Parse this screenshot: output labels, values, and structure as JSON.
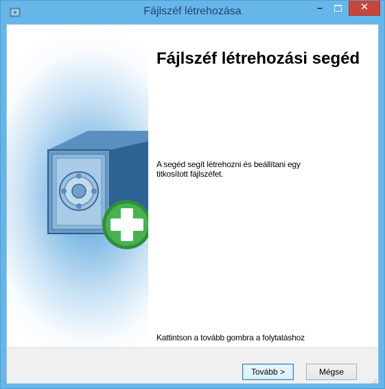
{
  "window": {
    "title": "Fájlszéf létrehozása",
    "controls": {
      "minimize": "–",
      "close": "✕"
    }
  },
  "wizard": {
    "heading": "Fájlszéf létrehozási segéd",
    "description": "A segéd segít létrehozni és beállítani egy titkosított fájlszéfet.",
    "hint": "Kattintson a tovább gombra a folytatáshoz"
  },
  "buttons": {
    "next": "Tovább >",
    "cancel": "Mégse"
  },
  "icons": {
    "app": "app-icon",
    "banner": "safe-add-icon"
  },
  "colors": {
    "titlebar": "#66b6ea",
    "close": "#c7463a",
    "plus": "#3fa24a"
  }
}
